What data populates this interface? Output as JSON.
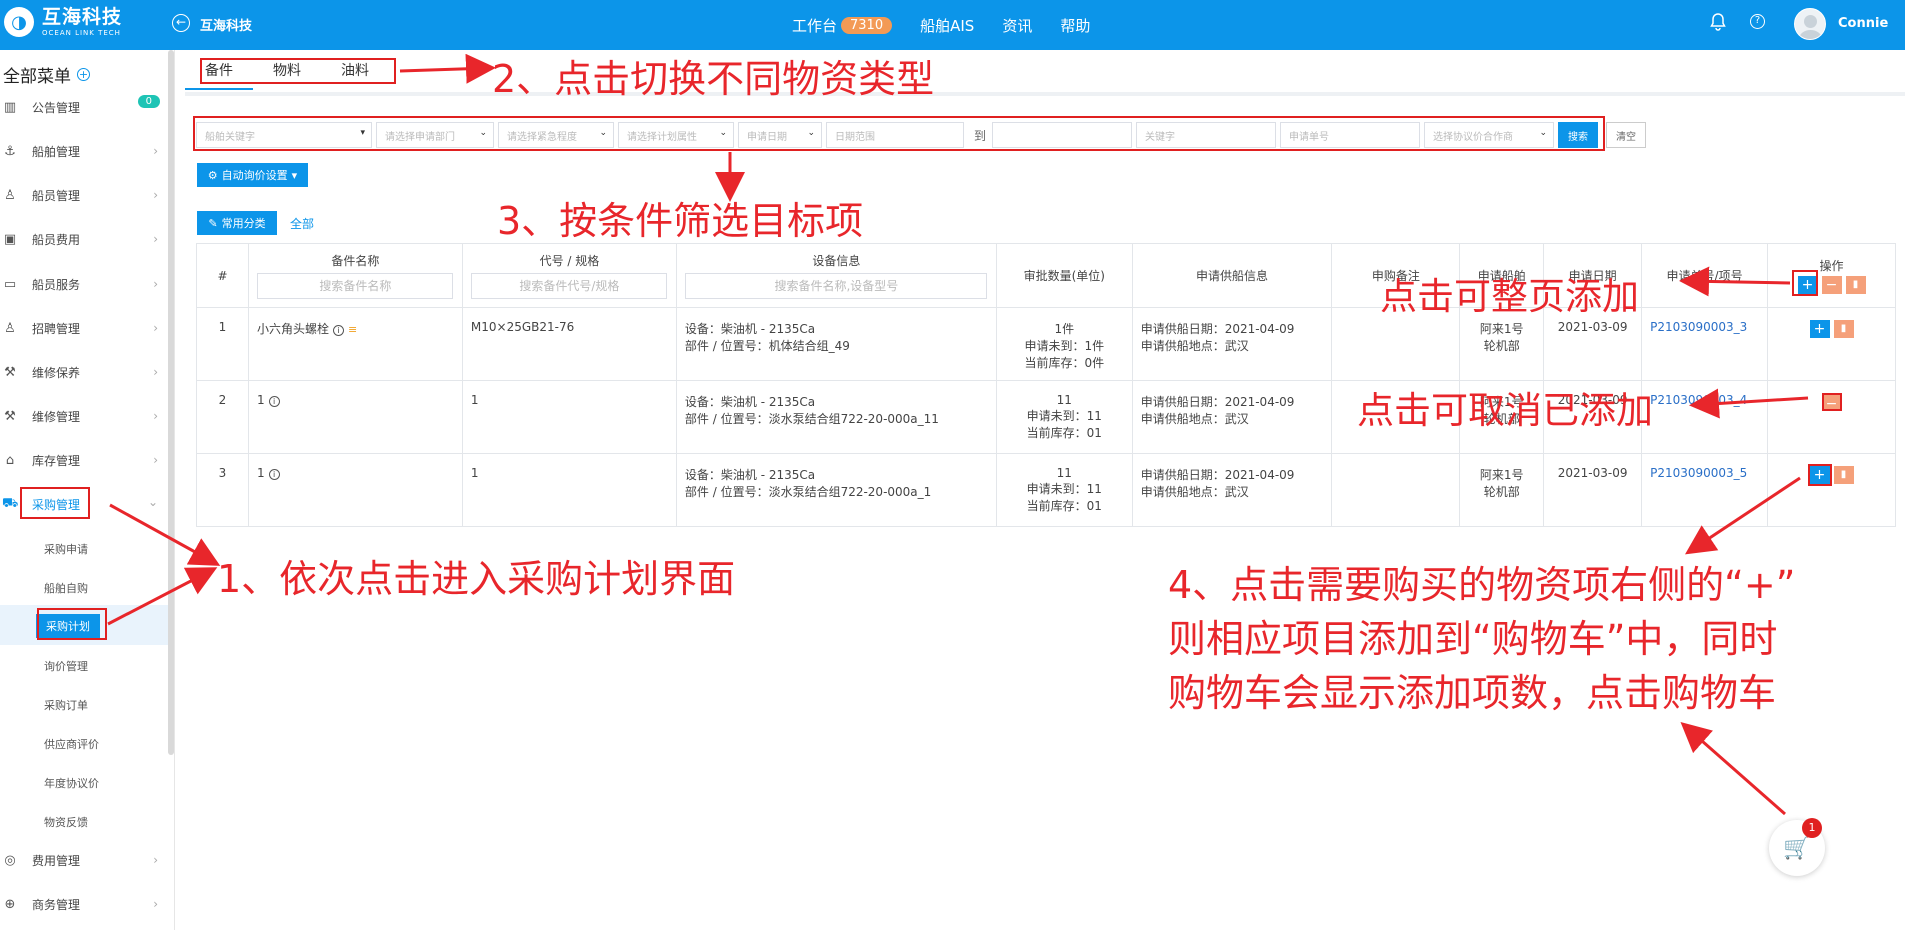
{
  "app": {
    "logo_cn": "互海科技",
    "logo_en": "OCEAN LINK TECH",
    "back_title": "互海科技",
    "username": "Connie"
  },
  "topnav": {
    "workbench": "工作台",
    "workbench_count": "7310",
    "ais": "船舶AIS",
    "news": "资讯",
    "help": "帮助"
  },
  "sidebar": {
    "header": "全部菜单",
    "items": [
      {
        "label": "公告管理",
        "badge": "0"
      },
      {
        "label": "船舶管理"
      },
      {
        "label": "船员管理"
      },
      {
        "label": "船员费用"
      },
      {
        "label": "船员服务"
      },
      {
        "label": "招聘管理"
      },
      {
        "label": "维修保养"
      },
      {
        "label": "维修管理"
      },
      {
        "label": "库存管理"
      },
      {
        "label": "采购管理"
      },
      {
        "label": "费用管理"
      },
      {
        "label": "商务管理"
      }
    ],
    "subitems": [
      "采购申请",
      "船舶自购",
      "采购计划",
      "询价管理",
      "采购订单",
      "供应商评价",
      "年度协议价",
      "物资反馈"
    ]
  },
  "tabs": [
    "备件",
    "物料",
    "油料"
  ],
  "filters": {
    "ship_keyword": "船舶关键字",
    "dept": "请选择申请部门",
    "urgency": "请选择紧急程度",
    "plan_attr": "请选择计划属性",
    "apply_date": "申请日期",
    "date_range": "日期范围",
    "to": "到",
    "keyword": "关键字",
    "apply_no": "申请单号",
    "supplier": "选择协议价合作商",
    "search": "搜索",
    "clear": "清空"
  },
  "buttons": {
    "auto_inquiry": "自动询价设置",
    "common_category": "常用分类",
    "all": "全部"
  },
  "table": {
    "headers": [
      "#",
      "备件名称",
      "代号 / 规格",
      "设备信息",
      "审批数量(单位)",
      "申请供船信息",
      "申购备注",
      "申请船舶",
      "申请日期",
      "申请单号/项号",
      "操作"
    ],
    "search_placeholders": {
      "name": "搜索备件名称",
      "code": "搜索备件代号/规格",
      "device": "搜索备件名称,设备型号"
    },
    "rows": [
      {
        "idx": "1",
        "name": "小六角头螺栓",
        "code": "M10×25GB21-76",
        "device_line1": "设备：柴油机 - 2135Ca",
        "device_line2": "部件 / 位置号：机体结合组_49",
        "qty": "1件",
        "qty_pending": "申请未到：1件",
        "qty_stock": "当前库存：0件",
        "supply_date": "申请供船日期：2021-04-09",
        "supply_place": "申请供船地点：武汉",
        "ship": "阿来1号",
        "dept": "轮机部",
        "date": "2021-03-09",
        "apply_no": "P2103090003_3"
      },
      {
        "idx": "2",
        "name": "1",
        "code": "1",
        "device_line1": "设备：柴油机 - 2135Ca",
        "device_line2": "部件 / 位置号：淡水泵结合组722-20-000a_11",
        "qty": "11",
        "qty_pending": "申请未到：11",
        "qty_stock": "当前库存：01",
        "supply_date": "申请供船日期：2021-04-09",
        "supply_place": "申请供船地点：武汉",
        "ship": "阿来1号",
        "dept": "轮机部",
        "date": "2021-03-09",
        "apply_no": "P2103090003_4"
      },
      {
        "idx": "3",
        "name": "1",
        "code": "1",
        "device_line1": "设备：柴油机 - 2135Ca",
        "device_line2": "部件 / 位置号：淡水泵结合组722-20-000a_1",
        "qty": "11",
        "qty_pending": "申请未到：11",
        "qty_stock": "当前库存：01",
        "supply_date": "申请供船日期：2021-04-09",
        "supply_place": "申请供船地点：武汉",
        "ship": "阿来1号",
        "dept": "轮机部",
        "date": "2021-03-09",
        "apply_no": "P2103090003_5"
      }
    ]
  },
  "cart_count": "1",
  "annotations": {
    "a1": "1、依次点击进入采购计划界面",
    "a2": "2、点击切换不同物资类型",
    "a3": "3、按条件筛选目标项",
    "a4_line1": "4、点击需要购买的物资项右侧的“+”",
    "a4_line2": "则相应项目添加到“购物车”中，同时",
    "a4_line3": "购物车会显示添加项数，点击购物车",
    "add_page": "点击可整页添加",
    "cancel_add": "点击可取消已添加"
  },
  "colors": {
    "brand": "#0c95e9",
    "annotation": "#e8262b",
    "badge": "#f39a55",
    "minus": "#f5a07a"
  }
}
